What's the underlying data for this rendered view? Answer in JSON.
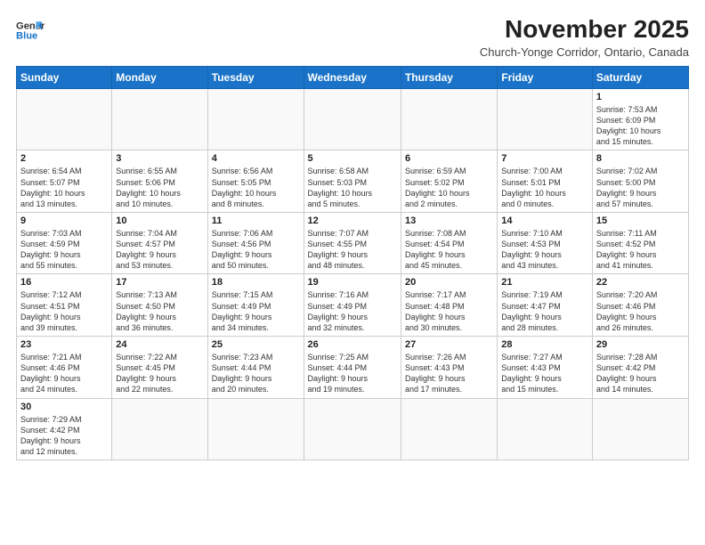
{
  "logo": {
    "line1": "General",
    "line2": "Blue"
  },
  "header": {
    "month_year": "November 2025",
    "subtitle": "Church-Yonge Corridor, Ontario, Canada"
  },
  "days_of_week": [
    "Sunday",
    "Monday",
    "Tuesday",
    "Wednesday",
    "Thursday",
    "Friday",
    "Saturday"
  ],
  "weeks": [
    [
      {
        "day": "",
        "info": ""
      },
      {
        "day": "",
        "info": ""
      },
      {
        "day": "",
        "info": ""
      },
      {
        "day": "",
        "info": ""
      },
      {
        "day": "",
        "info": ""
      },
      {
        "day": "",
        "info": ""
      },
      {
        "day": "1",
        "info": "Sunrise: 7:53 AM\nSunset: 6:09 PM\nDaylight: 10 hours\nand 15 minutes."
      }
    ],
    [
      {
        "day": "2",
        "info": "Sunrise: 6:54 AM\nSunset: 5:07 PM\nDaylight: 10 hours\nand 13 minutes."
      },
      {
        "day": "3",
        "info": "Sunrise: 6:55 AM\nSunset: 5:06 PM\nDaylight: 10 hours\nand 10 minutes."
      },
      {
        "day": "4",
        "info": "Sunrise: 6:56 AM\nSunset: 5:05 PM\nDaylight: 10 hours\nand 8 minutes."
      },
      {
        "day": "5",
        "info": "Sunrise: 6:58 AM\nSunset: 5:03 PM\nDaylight: 10 hours\nand 5 minutes."
      },
      {
        "day": "6",
        "info": "Sunrise: 6:59 AM\nSunset: 5:02 PM\nDaylight: 10 hours\nand 2 minutes."
      },
      {
        "day": "7",
        "info": "Sunrise: 7:00 AM\nSunset: 5:01 PM\nDaylight: 10 hours\nand 0 minutes."
      },
      {
        "day": "8",
        "info": "Sunrise: 7:02 AM\nSunset: 5:00 PM\nDaylight: 9 hours\nand 57 minutes."
      }
    ],
    [
      {
        "day": "9",
        "info": "Sunrise: 7:03 AM\nSunset: 4:59 PM\nDaylight: 9 hours\nand 55 minutes."
      },
      {
        "day": "10",
        "info": "Sunrise: 7:04 AM\nSunset: 4:57 PM\nDaylight: 9 hours\nand 53 minutes."
      },
      {
        "day": "11",
        "info": "Sunrise: 7:06 AM\nSunset: 4:56 PM\nDaylight: 9 hours\nand 50 minutes."
      },
      {
        "day": "12",
        "info": "Sunrise: 7:07 AM\nSunset: 4:55 PM\nDaylight: 9 hours\nand 48 minutes."
      },
      {
        "day": "13",
        "info": "Sunrise: 7:08 AM\nSunset: 4:54 PM\nDaylight: 9 hours\nand 45 minutes."
      },
      {
        "day": "14",
        "info": "Sunrise: 7:10 AM\nSunset: 4:53 PM\nDaylight: 9 hours\nand 43 minutes."
      },
      {
        "day": "15",
        "info": "Sunrise: 7:11 AM\nSunset: 4:52 PM\nDaylight: 9 hours\nand 41 minutes."
      }
    ],
    [
      {
        "day": "16",
        "info": "Sunrise: 7:12 AM\nSunset: 4:51 PM\nDaylight: 9 hours\nand 39 minutes."
      },
      {
        "day": "17",
        "info": "Sunrise: 7:13 AM\nSunset: 4:50 PM\nDaylight: 9 hours\nand 36 minutes."
      },
      {
        "day": "18",
        "info": "Sunrise: 7:15 AM\nSunset: 4:49 PM\nDaylight: 9 hours\nand 34 minutes."
      },
      {
        "day": "19",
        "info": "Sunrise: 7:16 AM\nSunset: 4:49 PM\nDaylight: 9 hours\nand 32 minutes."
      },
      {
        "day": "20",
        "info": "Sunrise: 7:17 AM\nSunset: 4:48 PM\nDaylight: 9 hours\nand 30 minutes."
      },
      {
        "day": "21",
        "info": "Sunrise: 7:19 AM\nSunset: 4:47 PM\nDaylight: 9 hours\nand 28 minutes."
      },
      {
        "day": "22",
        "info": "Sunrise: 7:20 AM\nSunset: 4:46 PM\nDaylight: 9 hours\nand 26 minutes."
      }
    ],
    [
      {
        "day": "23",
        "info": "Sunrise: 7:21 AM\nSunset: 4:46 PM\nDaylight: 9 hours\nand 24 minutes."
      },
      {
        "day": "24",
        "info": "Sunrise: 7:22 AM\nSunset: 4:45 PM\nDaylight: 9 hours\nand 22 minutes."
      },
      {
        "day": "25",
        "info": "Sunrise: 7:23 AM\nSunset: 4:44 PM\nDaylight: 9 hours\nand 20 minutes."
      },
      {
        "day": "26",
        "info": "Sunrise: 7:25 AM\nSunset: 4:44 PM\nDaylight: 9 hours\nand 19 minutes."
      },
      {
        "day": "27",
        "info": "Sunrise: 7:26 AM\nSunset: 4:43 PM\nDaylight: 9 hours\nand 17 minutes."
      },
      {
        "day": "28",
        "info": "Sunrise: 7:27 AM\nSunset: 4:43 PM\nDaylight: 9 hours\nand 15 minutes."
      },
      {
        "day": "29",
        "info": "Sunrise: 7:28 AM\nSunset: 4:42 PM\nDaylight: 9 hours\nand 14 minutes."
      }
    ],
    [
      {
        "day": "30",
        "info": "Sunrise: 7:29 AM\nSunset: 4:42 PM\nDaylight: 9 hours\nand 12 minutes."
      },
      {
        "day": "",
        "info": ""
      },
      {
        "day": "",
        "info": ""
      },
      {
        "day": "",
        "info": ""
      },
      {
        "day": "",
        "info": ""
      },
      {
        "day": "",
        "info": ""
      },
      {
        "day": "",
        "info": ""
      }
    ]
  ]
}
